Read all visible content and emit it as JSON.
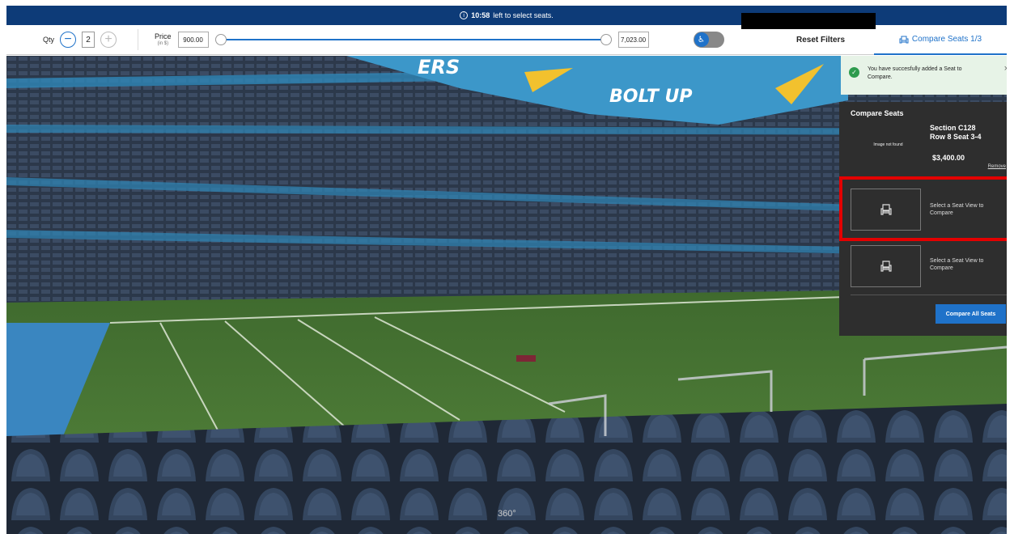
{
  "timer": {
    "time": "10:58",
    "text": "left to select seats."
  },
  "filters": {
    "qty_label": "Qty",
    "qty_value": "2",
    "qty_minus": "−",
    "qty_plus": "+",
    "price_label": "Price",
    "price_unit": "(in $)",
    "price_min": "900.00",
    "price_max": "7,023.00",
    "price_range_fraction": [
      0.0,
      1.0
    ],
    "accessibility_icon": "wheelchair-icon",
    "reset_label": "Reset Filters",
    "compare_label": "Compare Seats 1/3"
  },
  "toast": {
    "message": "You have succesfully added a Seat to Compare.",
    "close": "×"
  },
  "compare_panel": {
    "title": "Compare Seats",
    "selected": {
      "section": "Section C128",
      "row_seat": "Row 8 Seat 3-4",
      "price": "$3,400.00",
      "image_alt": "Image not found",
      "remove": "Remove"
    },
    "empty_slots": [
      {
        "text": "Select a Seat View to Compare"
      },
      {
        "text": "Select a Seat View to Compare"
      }
    ],
    "compare_all": "Compare All Seats"
  },
  "stadium": {
    "banner_left": "ERS",
    "banner_right": "BOLT UP"
  },
  "view_360": "360°",
  "colors": {
    "brand_blue": "#1f72c9",
    "header_navy": "#0d3b78",
    "panel_dark": "#2e2e2e",
    "highlight_red": "#e30000",
    "success_green": "#2e9b4e"
  }
}
